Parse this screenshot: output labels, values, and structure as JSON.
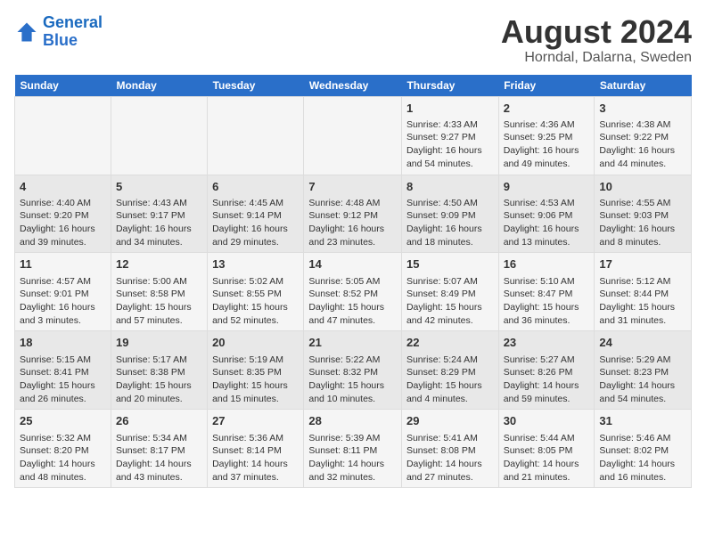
{
  "header": {
    "logo_line1": "General",
    "logo_line2": "Blue",
    "main_title": "August 2024",
    "subtitle": "Horndal, Dalarna, Sweden"
  },
  "weekdays": [
    "Sunday",
    "Monday",
    "Tuesday",
    "Wednesday",
    "Thursday",
    "Friday",
    "Saturday"
  ],
  "weeks": [
    [
      {
        "day": "",
        "content": ""
      },
      {
        "day": "",
        "content": ""
      },
      {
        "day": "",
        "content": ""
      },
      {
        "day": "",
        "content": ""
      },
      {
        "day": "1",
        "content": "Sunrise: 4:33 AM\nSunset: 9:27 PM\nDaylight: 16 hours\nand 54 minutes."
      },
      {
        "day": "2",
        "content": "Sunrise: 4:36 AM\nSunset: 9:25 PM\nDaylight: 16 hours\nand 49 minutes."
      },
      {
        "day": "3",
        "content": "Sunrise: 4:38 AM\nSunset: 9:22 PM\nDaylight: 16 hours\nand 44 minutes."
      }
    ],
    [
      {
        "day": "4",
        "content": "Sunrise: 4:40 AM\nSunset: 9:20 PM\nDaylight: 16 hours\nand 39 minutes."
      },
      {
        "day": "5",
        "content": "Sunrise: 4:43 AM\nSunset: 9:17 PM\nDaylight: 16 hours\nand 34 minutes."
      },
      {
        "day": "6",
        "content": "Sunrise: 4:45 AM\nSunset: 9:14 PM\nDaylight: 16 hours\nand 29 minutes."
      },
      {
        "day": "7",
        "content": "Sunrise: 4:48 AM\nSunset: 9:12 PM\nDaylight: 16 hours\nand 23 minutes."
      },
      {
        "day": "8",
        "content": "Sunrise: 4:50 AM\nSunset: 9:09 PM\nDaylight: 16 hours\nand 18 minutes."
      },
      {
        "day": "9",
        "content": "Sunrise: 4:53 AM\nSunset: 9:06 PM\nDaylight: 16 hours\nand 13 minutes."
      },
      {
        "day": "10",
        "content": "Sunrise: 4:55 AM\nSunset: 9:03 PM\nDaylight: 16 hours\nand 8 minutes."
      }
    ],
    [
      {
        "day": "11",
        "content": "Sunrise: 4:57 AM\nSunset: 9:01 PM\nDaylight: 16 hours\nand 3 minutes."
      },
      {
        "day": "12",
        "content": "Sunrise: 5:00 AM\nSunset: 8:58 PM\nDaylight: 15 hours\nand 57 minutes."
      },
      {
        "day": "13",
        "content": "Sunrise: 5:02 AM\nSunset: 8:55 PM\nDaylight: 15 hours\nand 52 minutes."
      },
      {
        "day": "14",
        "content": "Sunrise: 5:05 AM\nSunset: 8:52 PM\nDaylight: 15 hours\nand 47 minutes."
      },
      {
        "day": "15",
        "content": "Sunrise: 5:07 AM\nSunset: 8:49 PM\nDaylight: 15 hours\nand 42 minutes."
      },
      {
        "day": "16",
        "content": "Sunrise: 5:10 AM\nSunset: 8:47 PM\nDaylight: 15 hours\nand 36 minutes."
      },
      {
        "day": "17",
        "content": "Sunrise: 5:12 AM\nSunset: 8:44 PM\nDaylight: 15 hours\nand 31 minutes."
      }
    ],
    [
      {
        "day": "18",
        "content": "Sunrise: 5:15 AM\nSunset: 8:41 PM\nDaylight: 15 hours\nand 26 minutes."
      },
      {
        "day": "19",
        "content": "Sunrise: 5:17 AM\nSunset: 8:38 PM\nDaylight: 15 hours\nand 20 minutes."
      },
      {
        "day": "20",
        "content": "Sunrise: 5:19 AM\nSunset: 8:35 PM\nDaylight: 15 hours\nand 15 minutes."
      },
      {
        "day": "21",
        "content": "Sunrise: 5:22 AM\nSunset: 8:32 PM\nDaylight: 15 hours\nand 10 minutes."
      },
      {
        "day": "22",
        "content": "Sunrise: 5:24 AM\nSunset: 8:29 PM\nDaylight: 15 hours\nand 4 minutes."
      },
      {
        "day": "23",
        "content": "Sunrise: 5:27 AM\nSunset: 8:26 PM\nDaylight: 14 hours\nand 59 minutes."
      },
      {
        "day": "24",
        "content": "Sunrise: 5:29 AM\nSunset: 8:23 PM\nDaylight: 14 hours\nand 54 minutes."
      }
    ],
    [
      {
        "day": "25",
        "content": "Sunrise: 5:32 AM\nSunset: 8:20 PM\nDaylight: 14 hours\nand 48 minutes."
      },
      {
        "day": "26",
        "content": "Sunrise: 5:34 AM\nSunset: 8:17 PM\nDaylight: 14 hours\nand 43 minutes."
      },
      {
        "day": "27",
        "content": "Sunrise: 5:36 AM\nSunset: 8:14 PM\nDaylight: 14 hours\nand 37 minutes."
      },
      {
        "day": "28",
        "content": "Sunrise: 5:39 AM\nSunset: 8:11 PM\nDaylight: 14 hours\nand 32 minutes."
      },
      {
        "day": "29",
        "content": "Sunrise: 5:41 AM\nSunset: 8:08 PM\nDaylight: 14 hours\nand 27 minutes."
      },
      {
        "day": "30",
        "content": "Sunrise: 5:44 AM\nSunset: 8:05 PM\nDaylight: 14 hours\nand 21 minutes."
      },
      {
        "day": "31",
        "content": "Sunrise: 5:46 AM\nSunset: 8:02 PM\nDaylight: 14 hours\nand 16 minutes."
      }
    ]
  ]
}
